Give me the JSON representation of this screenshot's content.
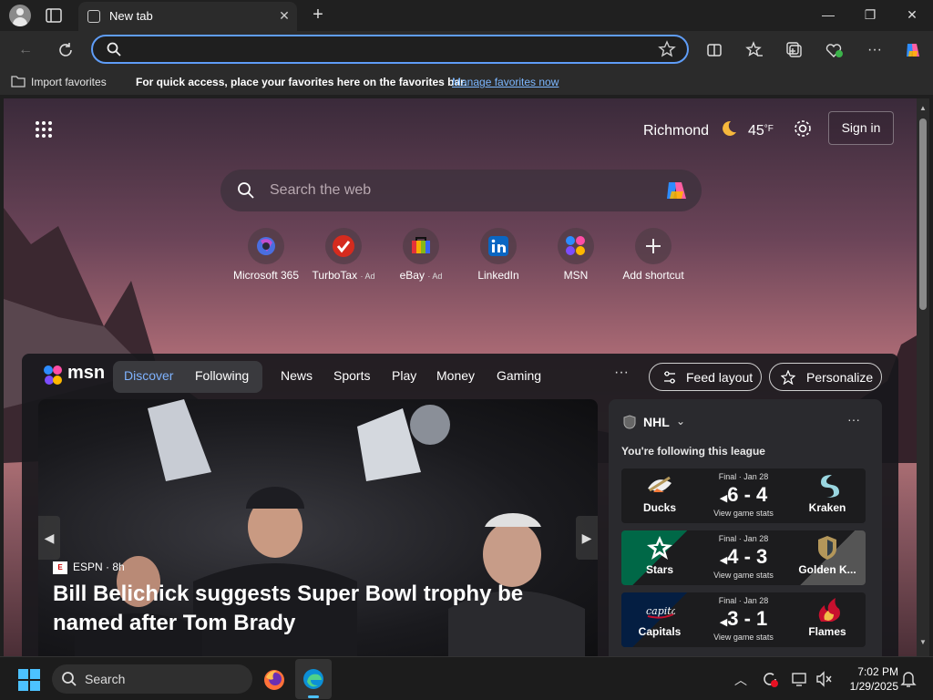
{
  "browser": {
    "tab_title": "New tab",
    "address_value": "",
    "address_placeholder": ""
  },
  "favorites_bar": {
    "import_label": "Import favorites",
    "message": "For quick access, place your favorites here on the favorites bar.",
    "manage_link": "Manage favorites now"
  },
  "newtab": {
    "weather": {
      "city": "Richmond",
      "temp": "45",
      "unit": "°F"
    },
    "signin_label": "Sign in",
    "search_placeholder": "Search the web",
    "shortcuts": [
      {
        "label": "Microsoft 365",
        "ad": ""
      },
      {
        "label": "TurboTax",
        "ad": "Ad"
      },
      {
        "label": "eBay",
        "ad": "Ad"
      },
      {
        "label": "LinkedIn",
        "ad": ""
      },
      {
        "label": "MSN",
        "ad": ""
      },
      {
        "label": "Add shortcut",
        "ad": ""
      }
    ]
  },
  "feed": {
    "brand": "msn",
    "pills": [
      "Discover",
      "Following"
    ],
    "nav": [
      "News",
      "Sports",
      "Play",
      "Money",
      "Gaming"
    ],
    "more": "···",
    "feed_layout_label": "Feed layout",
    "personalize_label": "Personalize",
    "hero": {
      "source": "ESPN",
      "source_logo": "E",
      "age": "· 8h",
      "title": "Bill Belichick suggests Super Bowl trophy be named after Tom Brady"
    }
  },
  "nhl": {
    "title": "NHL",
    "subtitle": "You're following this league",
    "games": [
      {
        "status": "Final · Jan 28",
        "score": "6 - 4",
        "stats": "View game stats",
        "home": "Ducks",
        "away": "Kraken"
      },
      {
        "status": "Final · Jan 28",
        "score": "4 - 3",
        "stats": "View game stats",
        "home": "Stars",
        "away": "Golden K..."
      },
      {
        "status": "Final · Jan 28",
        "score": "3 - 1",
        "stats": "View game stats",
        "home": "Capitals",
        "away": "Flames"
      }
    ]
  },
  "taskbar": {
    "search_label": "Search",
    "time": "7:02 PM",
    "date": "1/29/2025"
  },
  "colors": {
    "accent": "#5f9df7",
    "link": "#7cb7ff",
    "active_pill": "#7fb3ff"
  }
}
